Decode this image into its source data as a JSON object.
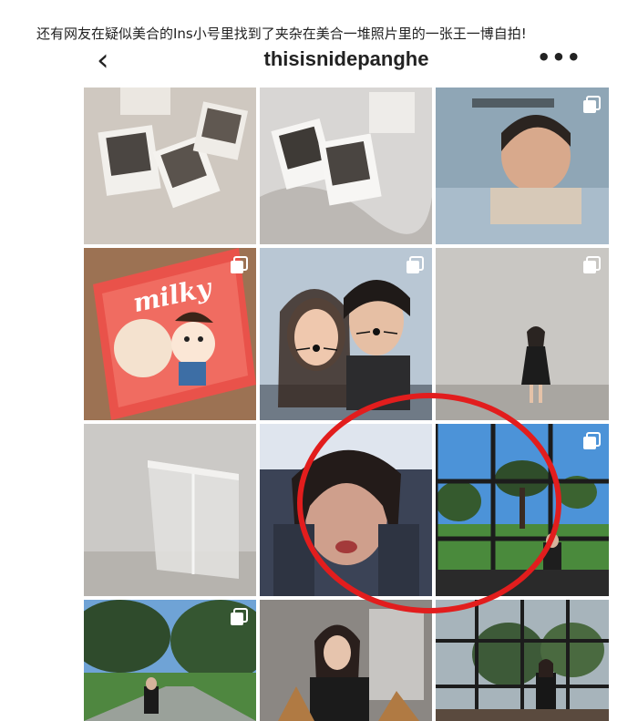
{
  "article": {
    "caption": "还有网友在疑似美合的Ins小号里找到了夹杂在美合一堆照片里的一张王一博自拍!"
  },
  "header": {
    "back_icon": "chevron-left-icon",
    "username": "thisisnidepanghe",
    "more_icon": "more-horizontal-icon"
  },
  "posts": [
    {
      "row": 1,
      "col": 1,
      "subject": "instant photos on white sheet",
      "multi": false
    },
    {
      "row": 1,
      "col": 2,
      "subject": "instant photos on bed",
      "multi": false
    },
    {
      "row": 1,
      "col": 3,
      "subject": "sleeping child",
      "multi": true
    },
    {
      "row": 2,
      "col": 1,
      "subject": "milky candy wrapper",
      "multi": true,
      "wrapper_text": "milky"
    },
    {
      "row": 2,
      "col": 2,
      "subject": "couple selfie with whisker filter",
      "multi": true
    },
    {
      "row": 2,
      "col": 3,
      "subject": "woman in black dress, sparkling wall",
      "multi": true
    },
    {
      "row": 3,
      "col": 1,
      "subject": "sparkling glass room",
      "multi": false
    },
    {
      "row": 3,
      "col": 2,
      "subject": "blurry selfie",
      "multi": false,
      "highlighted": true
    },
    {
      "row": 3,
      "col": 3,
      "subject": "garden window view",
      "multi": true
    },
    {
      "row": 4,
      "col": 1,
      "subject": "woman on tree-lined path",
      "multi": true
    },
    {
      "row": 4,
      "col": 2,
      "subject": "woman seated in dark room",
      "multi": false
    },
    {
      "row": 4,
      "col": 3,
      "subject": "woman by glass windows",
      "multi": false
    }
  ],
  "colors": {
    "highlight": "#e21d1d",
    "text": "#222222"
  }
}
